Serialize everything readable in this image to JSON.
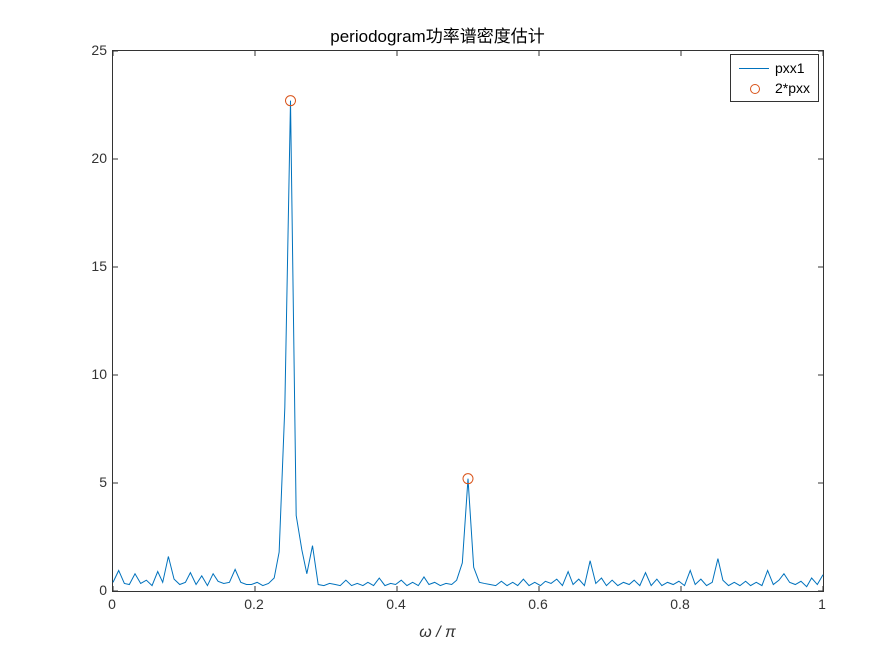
{
  "chart_data": {
    "type": "line",
    "title": "periodogram功率谱密度估计",
    "xlabel": "ω / π",
    "ylabel": "",
    "xlim": [
      0,
      1
    ],
    "ylim": [
      0,
      25
    ],
    "xticks": [
      0,
      0.2,
      0.4,
      0.6,
      0.8,
      1
    ],
    "yticks": [
      0,
      5,
      10,
      15,
      20,
      25
    ],
    "series": [
      {
        "name": "pxx1",
        "color": "#0072BD",
        "x": [
          0.0,
          0.008,
          0.016,
          0.023,
          0.031,
          0.039,
          0.047,
          0.055,
          0.063,
          0.07,
          0.078,
          0.086,
          0.094,
          0.102,
          0.109,
          0.117,
          0.125,
          0.133,
          0.141,
          0.148,
          0.156,
          0.164,
          0.172,
          0.18,
          0.188,
          0.195,
          0.203,
          0.211,
          0.219,
          0.227,
          0.234,
          0.242,
          0.25,
          0.258,
          0.266,
          0.273,
          0.281,
          0.289,
          0.297,
          0.305,
          0.313,
          0.32,
          0.328,
          0.336,
          0.344,
          0.352,
          0.359,
          0.367,
          0.375,
          0.383,
          0.391,
          0.398,
          0.406,
          0.414,
          0.422,
          0.43,
          0.438,
          0.445,
          0.453,
          0.461,
          0.469,
          0.477,
          0.484,
          0.492,
          0.5,
          0.508,
          0.516,
          0.523,
          0.531,
          0.539,
          0.547,
          0.555,
          0.563,
          0.57,
          0.578,
          0.586,
          0.594,
          0.602,
          0.609,
          0.617,
          0.625,
          0.633,
          0.641,
          0.648,
          0.656,
          0.664,
          0.672,
          0.68,
          0.688,
          0.695,
          0.703,
          0.711,
          0.719,
          0.727,
          0.734,
          0.742,
          0.75,
          0.758,
          0.766,
          0.773,
          0.781,
          0.789,
          0.797,
          0.805,
          0.813,
          0.82,
          0.828,
          0.836,
          0.844,
          0.852,
          0.859,
          0.867,
          0.875,
          0.883,
          0.891,
          0.898,
          0.906,
          0.914,
          0.922,
          0.93,
          0.938,
          0.945,
          0.953,
          0.961,
          0.969,
          0.977,
          0.984,
          0.992,
          1.0
        ],
        "values": [
          0.4,
          0.95,
          0.35,
          0.3,
          0.8,
          0.35,
          0.5,
          0.25,
          0.9,
          0.4,
          1.6,
          0.55,
          0.3,
          0.4,
          0.85,
          0.3,
          0.7,
          0.25,
          0.8,
          0.45,
          0.35,
          0.4,
          1.0,
          0.4,
          0.3,
          0.3,
          0.4,
          0.25,
          0.35,
          0.6,
          1.8,
          8.5,
          22.7,
          3.5,
          1.9,
          0.8,
          2.1,
          0.3,
          0.25,
          0.35,
          0.3,
          0.25,
          0.5,
          0.25,
          0.35,
          0.25,
          0.4,
          0.25,
          0.6,
          0.25,
          0.35,
          0.3,
          0.5,
          0.25,
          0.4,
          0.25,
          0.65,
          0.3,
          0.4,
          0.25,
          0.35,
          0.3,
          0.5,
          1.3,
          5.2,
          1.1,
          0.4,
          0.35,
          0.3,
          0.25,
          0.45,
          0.25,
          0.4,
          0.25,
          0.55,
          0.25,
          0.4,
          0.25,
          0.45,
          0.35,
          0.55,
          0.25,
          0.9,
          0.3,
          0.55,
          0.25,
          1.4,
          0.35,
          0.6,
          0.25,
          0.5,
          0.25,
          0.4,
          0.3,
          0.5,
          0.25,
          0.85,
          0.25,
          0.55,
          0.25,
          0.4,
          0.3,
          0.45,
          0.25,
          0.95,
          0.3,
          0.55,
          0.25,
          0.4,
          1.5,
          0.5,
          0.25,
          0.4,
          0.25,
          0.45,
          0.25,
          0.4,
          0.25,
          0.95,
          0.3,
          0.5,
          0.8,
          0.4,
          0.3,
          0.45,
          0.2,
          0.6,
          0.3,
          0.75
        ]
      },
      {
        "name": "2*pxx",
        "marker": "circle",
        "color": "#D95319",
        "x": [
          0.25,
          0.5
        ],
        "values": [
          22.7,
          5.2
        ]
      }
    ],
    "legend": {
      "position": "northeast",
      "entries": [
        "pxx1",
        "2*pxx"
      ]
    }
  }
}
